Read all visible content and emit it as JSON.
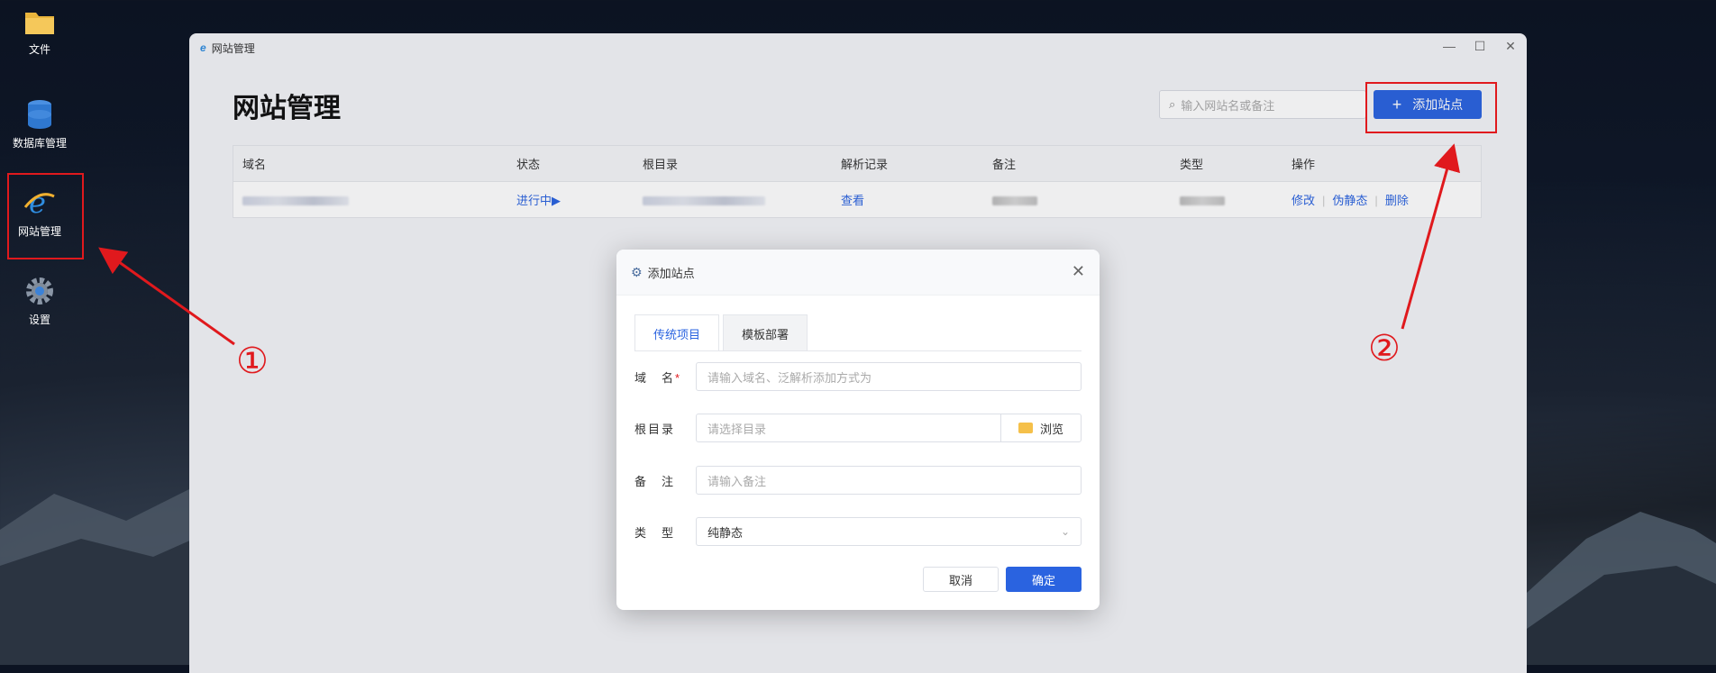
{
  "desktop": {
    "icons": [
      {
        "label": "文件",
        "icon": "folder-icon"
      },
      {
        "label": "数据库管理",
        "icon": "database-icon"
      },
      {
        "label": "网站管理",
        "icon": "ie-icon"
      },
      {
        "label": "设置",
        "icon": "gear-icon"
      }
    ]
  },
  "window": {
    "title": "网站管理",
    "page_title": "网站管理",
    "search_placeholder": "输入网站名或备注",
    "add_button": "添加站点",
    "table": {
      "headers": [
        "域名",
        "状态",
        "根目录",
        "解析记录",
        "备注",
        "类型",
        "操作"
      ],
      "row": {
        "status": "进行中▶",
        "dns": "查看",
        "ops": [
          "修改",
          "伪静态",
          "删除"
        ]
      }
    }
  },
  "dialog": {
    "title": "添加站点",
    "tabs": [
      "传统项目",
      "模板部署"
    ],
    "fields": {
      "domain": {
        "label": "域　名",
        "placeholder": "请输入域名、泛解析添加方式为"
      },
      "root": {
        "label": "根目录",
        "placeholder": "请选择目录",
        "browse": "浏览"
      },
      "remark": {
        "label": "备　注",
        "placeholder": "请输入备注"
      },
      "type": {
        "label": "类　型",
        "value": "纯静态"
      }
    },
    "cancel": "取消",
    "confirm": "确定"
  },
  "annotations": {
    "one": "①",
    "two": "②"
  },
  "colors": {
    "accent": "#2a63e0",
    "highlight": "#e0191d"
  }
}
